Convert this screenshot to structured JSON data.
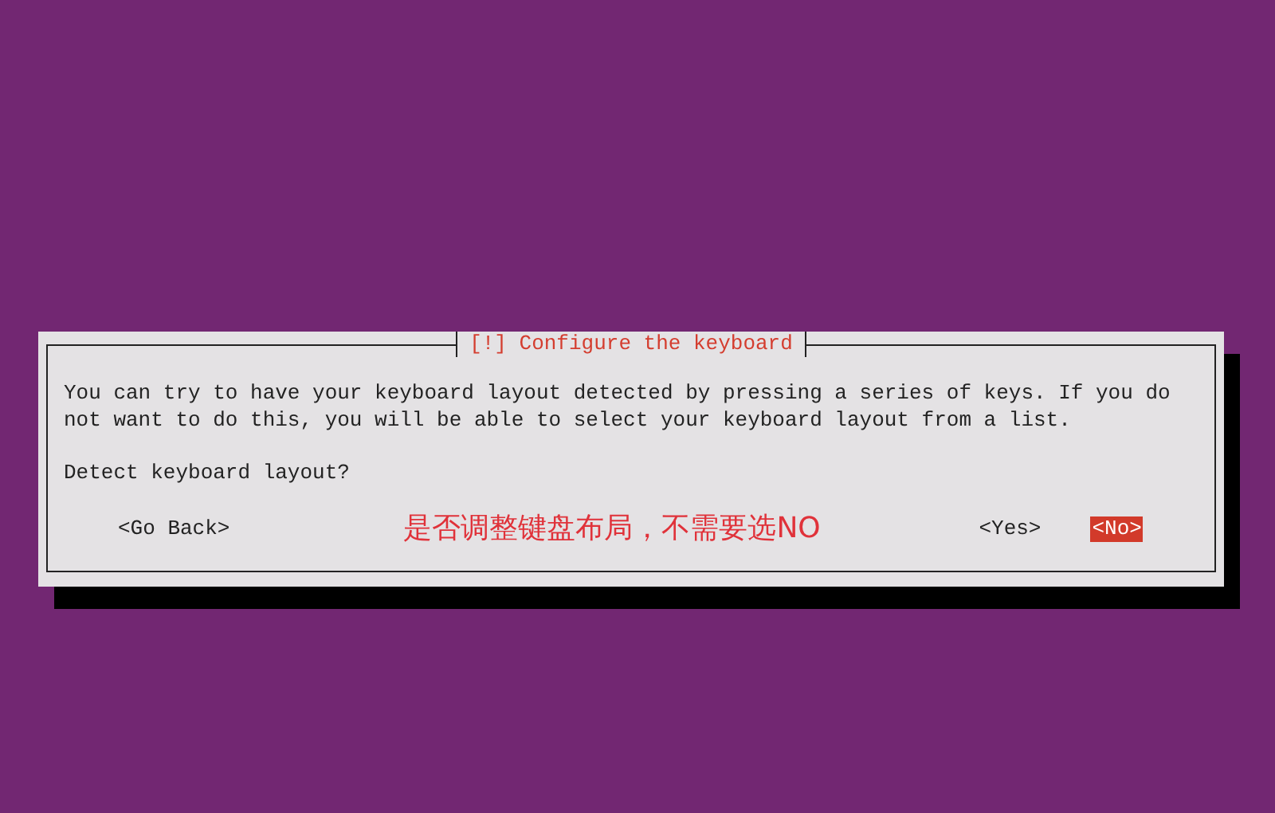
{
  "dialog": {
    "title": "[!] Configure the keyboard",
    "message": "You can try to have your keyboard layout detected by pressing a series of keys. If you do not want to do this, you will be able to select your keyboard layout from a list.",
    "question": "Detect keyboard layout?",
    "buttons": [
      {
        "label": "<Go Back>",
        "selected": false
      },
      {
        "label": "<Yes>",
        "selected": false
      },
      {
        "label": "<No>",
        "selected": true
      }
    ],
    "annotation": "是否调整键盘布局，不需要选NO"
  }
}
